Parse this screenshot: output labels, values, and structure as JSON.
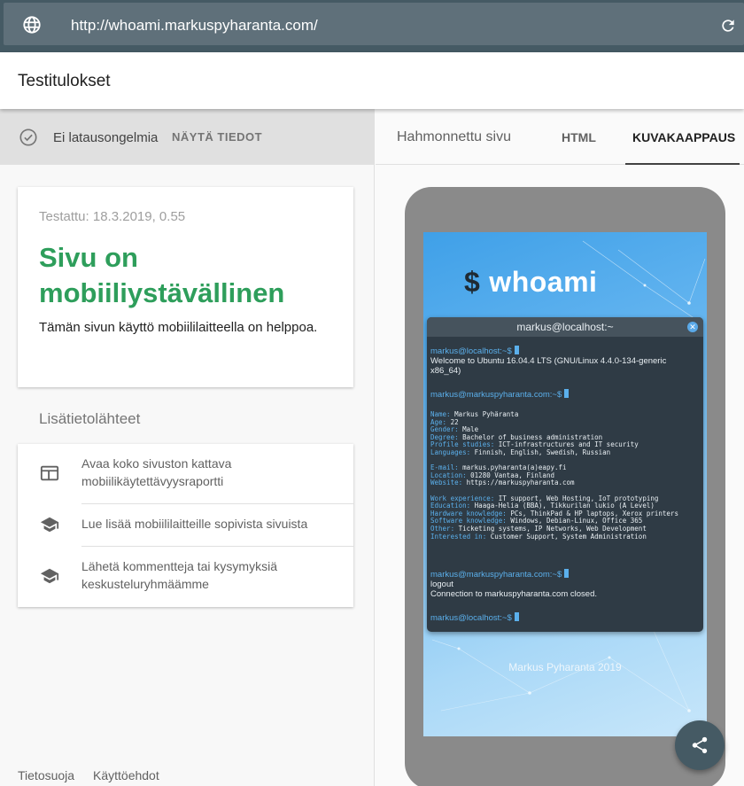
{
  "browser": {
    "url": "http://whoami.markuspyharanta.com/"
  },
  "header": {
    "title": "Testitulokset"
  },
  "status": {
    "text": "Ei latausongelmia",
    "details_link": "NÄYTÄ TIEDOT"
  },
  "result": {
    "tested": "Testattu: 18.3.2019, 0.55",
    "verdict": "Sivu on mobiiliystävällinen",
    "description": "Tämän sivun käyttö mobiililaitteella on helppoa."
  },
  "resources": {
    "heading": "Lisätietolähteet",
    "items": [
      {
        "icon": "web-layout-icon",
        "label": "Avaa koko sivuston kattava mobiilikäytettävyysraportti"
      },
      {
        "icon": "school-icon",
        "label": "Lue lisää mobiililaitteille sopivista sivuista"
      },
      {
        "icon": "school-icon",
        "label": "Lähetä kommentteja tai kysymyksiä keskusteluryhmäämme"
      }
    ]
  },
  "footer": {
    "privacy": "Tietosuoja",
    "terms": "Käyttöehdot"
  },
  "tabs": [
    {
      "label": "Hahmonnettu sivu"
    },
    {
      "label": "HTML"
    },
    {
      "label": "KUVAKAAPPAUS",
      "active": true
    }
  ],
  "preview": {
    "logo": "whoami",
    "logo_prefix": "$",
    "terminal_title": "markus@localhost:~",
    "prompt1": "markus@localhost:~$",
    "welcome1": "Welcome to Ubuntu 16.04.4 LTS (GNU/Linux 4.4.0-134-generic",
    "welcome2": "x86_64)",
    "prompt2": "markus@markuspyharanta.com:~$",
    "info": [
      {
        "label": "Name:",
        "value": "Markus Pyhäranta"
      },
      {
        "label": "Age:",
        "value": "22"
      },
      {
        "label": "Gender:",
        "value": "Male"
      },
      {
        "label": "Degree:",
        "value": "Bachelor of business administration"
      },
      {
        "label": "Profile studies:",
        "value": "ICT-infrastructures and IT security"
      },
      {
        "label": "Languages:",
        "value": "Finnish, English, Swedish, Russian"
      },
      {
        "label": "E-mail:",
        "value": "markus.pyharanta(a)eapy.fi"
      },
      {
        "label": "Location:",
        "value": "01280 Vantaa, Finland"
      },
      {
        "label": "Website:",
        "value": "https://markuspyharanta.com"
      },
      {
        "label": "Work experience:",
        "value": "IT support, Web Hosting, IoT prototyping"
      },
      {
        "label": "Education:",
        "value": "Haaga-Helia (BBA), Tikkurilan lukio (A Level)"
      },
      {
        "label": "Hardware knowledge:",
        "value": "PCs, ThinkPad & HP laptops, Xerox printers"
      },
      {
        "label": "Software knowledge:",
        "value": "Windows, Debian-Linux, Office 365"
      },
      {
        "label": "Other:",
        "value": "Ticketing systems, IP Networks, Web Development"
      },
      {
        "label": "Interested in:",
        "value": "Customer Support, System Administration"
      }
    ],
    "prompt3": "markus@markuspyharanta.com:~$",
    "logout": "logout",
    "closed": "Connection to markuspyharanta.com closed.",
    "prompt4": "markus@localhost:~$",
    "copyright": "Markus Pyharanta 2019"
  },
  "colors": {
    "verdict_green": "#2e9e5b",
    "toolbar": "#455a64",
    "accent_blue": "#5bb0ec"
  }
}
